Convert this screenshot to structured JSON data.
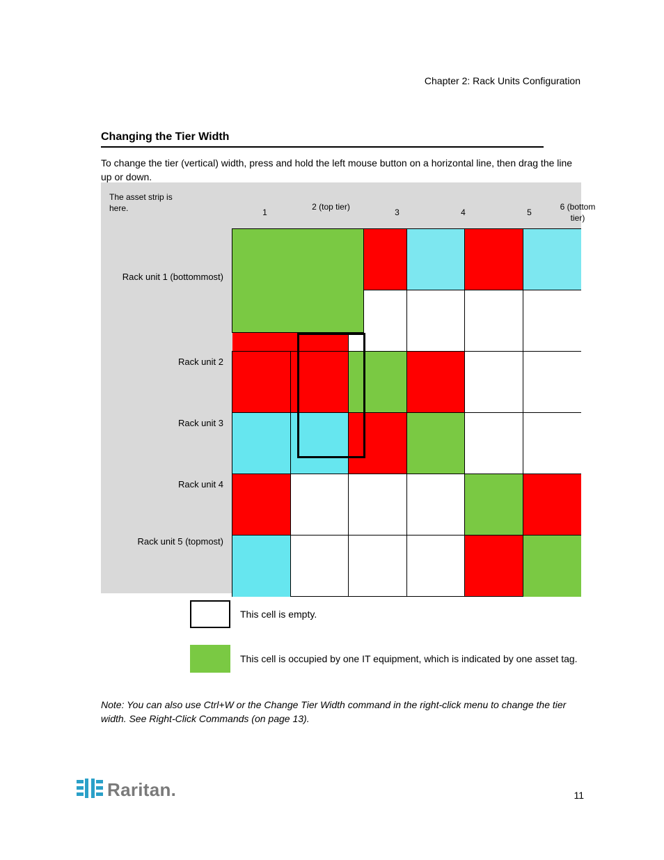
{
  "chapter_label": "Chapter 2: Rack Units Configuration",
  "section_title": "Changing the Tier Width",
  "intro": "To change the tier (vertical) width, press and hold the left mouse button on a horizontal line, then drag the line up or down.",
  "grid": {
    "origin_label_line1": "The asset strip is",
    "origin_label_line2": "here.",
    "columns": [
      "1",
      "2 (top tier)",
      "3",
      "4",
      "5",
      "6 (bottom tier)"
    ],
    "rows": [
      "Rack unit 1 (bottommost)",
      "Rack unit 2",
      "Rack unit 3",
      "Rack unit 4",
      "Rack unit 5 (topmost)"
    ],
    "cells": [
      [
        "",
        "",
        "R",
        "C2",
        "R",
        "C2"
      ],
      [
        "",
        "",
        "W",
        "W",
        "W",
        "W"
      ],
      [
        "R",
        "R",
        "G",
        "R",
        "W",
        "W"
      ],
      [
        "C",
        "C",
        "R",
        "G",
        "W",
        "W"
      ],
      [
        "R",
        "W",
        "W",
        "W",
        "G",
        "R"
      ],
      [
        "C",
        "W",
        "W",
        "W",
        "R",
        "G"
      ]
    ]
  },
  "legend": {
    "white": "This cell is empty.",
    "green": "This cell is occupied by one IT equipment, which is indicated by one asset tag."
  },
  "note": "Note: You can also use Ctrl+W or the Change Tier Width command in the right-click menu to change the tier width. See Right-Click Commands (on page 13).",
  "page_number": "11",
  "logo_text": "Raritan."
}
